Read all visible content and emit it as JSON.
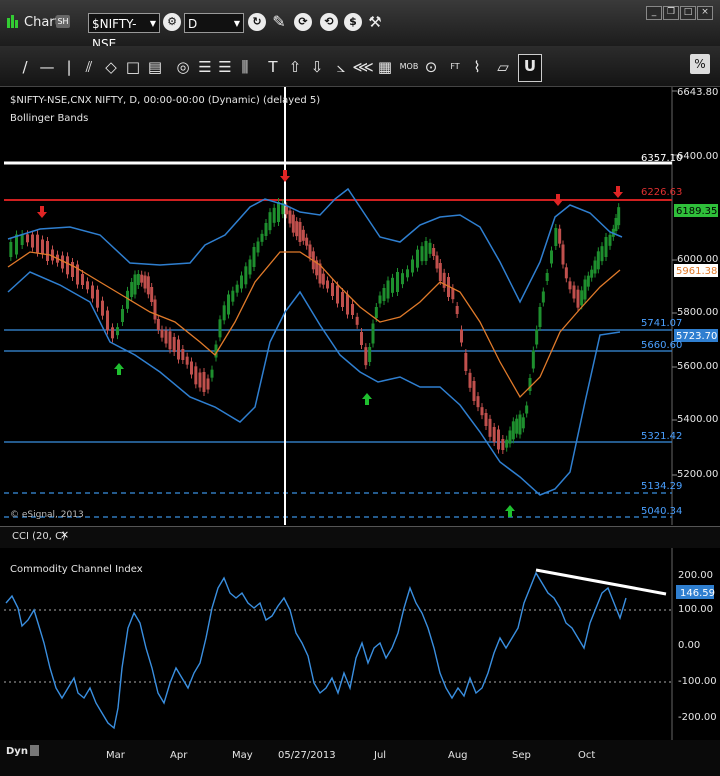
{
  "window": {
    "title": "Chart",
    "badge": "SH",
    "symbol_value": "$NIFTY-NSE",
    "interval_value": "D"
  },
  "icons": {
    "chart": "chart-icon",
    "gear": "gear-icon",
    "link": "link-icon",
    "pencil": "pencil-icon",
    "refresh": "refresh-icon",
    "dollar": "dollar-icon",
    "wrench": "wrench-icon",
    "minimize": "minimize-icon",
    "restore": "restore-icon",
    "close": "close-icon"
  },
  "toolbar_tools": [
    "/",
    "—",
    "|",
    "⫽",
    "◇",
    "□",
    "▤",
    "◎",
    "☰",
    "☰",
    "⫼",
    "T",
    "⇧",
    "⇩",
    "⦣",
    "⋘",
    "▦",
    "MOB",
    "⊙",
    "FT",
    "⌇",
    "▱"
  ],
  "main_chart": {
    "header_line1": "$NIFTY-NSE,CNX NIFTY, D, 00:00-00:00 (Dynamic) (delayed 5)",
    "header_line2": "Bollinger Bands",
    "copyright": "© eSignal, 2013",
    "price_labels": [
      "6643.80",
      "6400.00",
      "6200.00",
      "6000.00",
      "5800.00",
      "5600.00",
      "5400.00",
      "5200.00"
    ],
    "level_labels": [
      "6357.10",
      "6226.63",
      "6189.35",
      "5961.38",
      "5741.07",
      "5723.70",
      "5660.60",
      "5321.42",
      "5134.29",
      "5040.34"
    ],
    "colors": {
      "up": "#1e8f2e",
      "down": "#c0504d",
      "band": "#2f7fd0",
      "mid": "#e07a2a",
      "line_red": "#d02020",
      "line_blue": "#3a8fe0",
      "white": "#ffffff"
    }
  },
  "cci_panel": {
    "tab_label": "CCI (20, C)",
    "close_label": "×",
    "title": "Commodity Channel Index",
    "axis_labels": [
      "200.00",
      "100.00",
      "0.00",
      "-100.00",
      "-200.00"
    ],
    "current_value": "146.59"
  },
  "date_axis": {
    "dyn_label": "Dyn",
    "months": [
      "Mar",
      "Apr",
      "May",
      "05/27/2013",
      "Jul",
      "Aug",
      "Sep",
      "Oct"
    ]
  }
}
